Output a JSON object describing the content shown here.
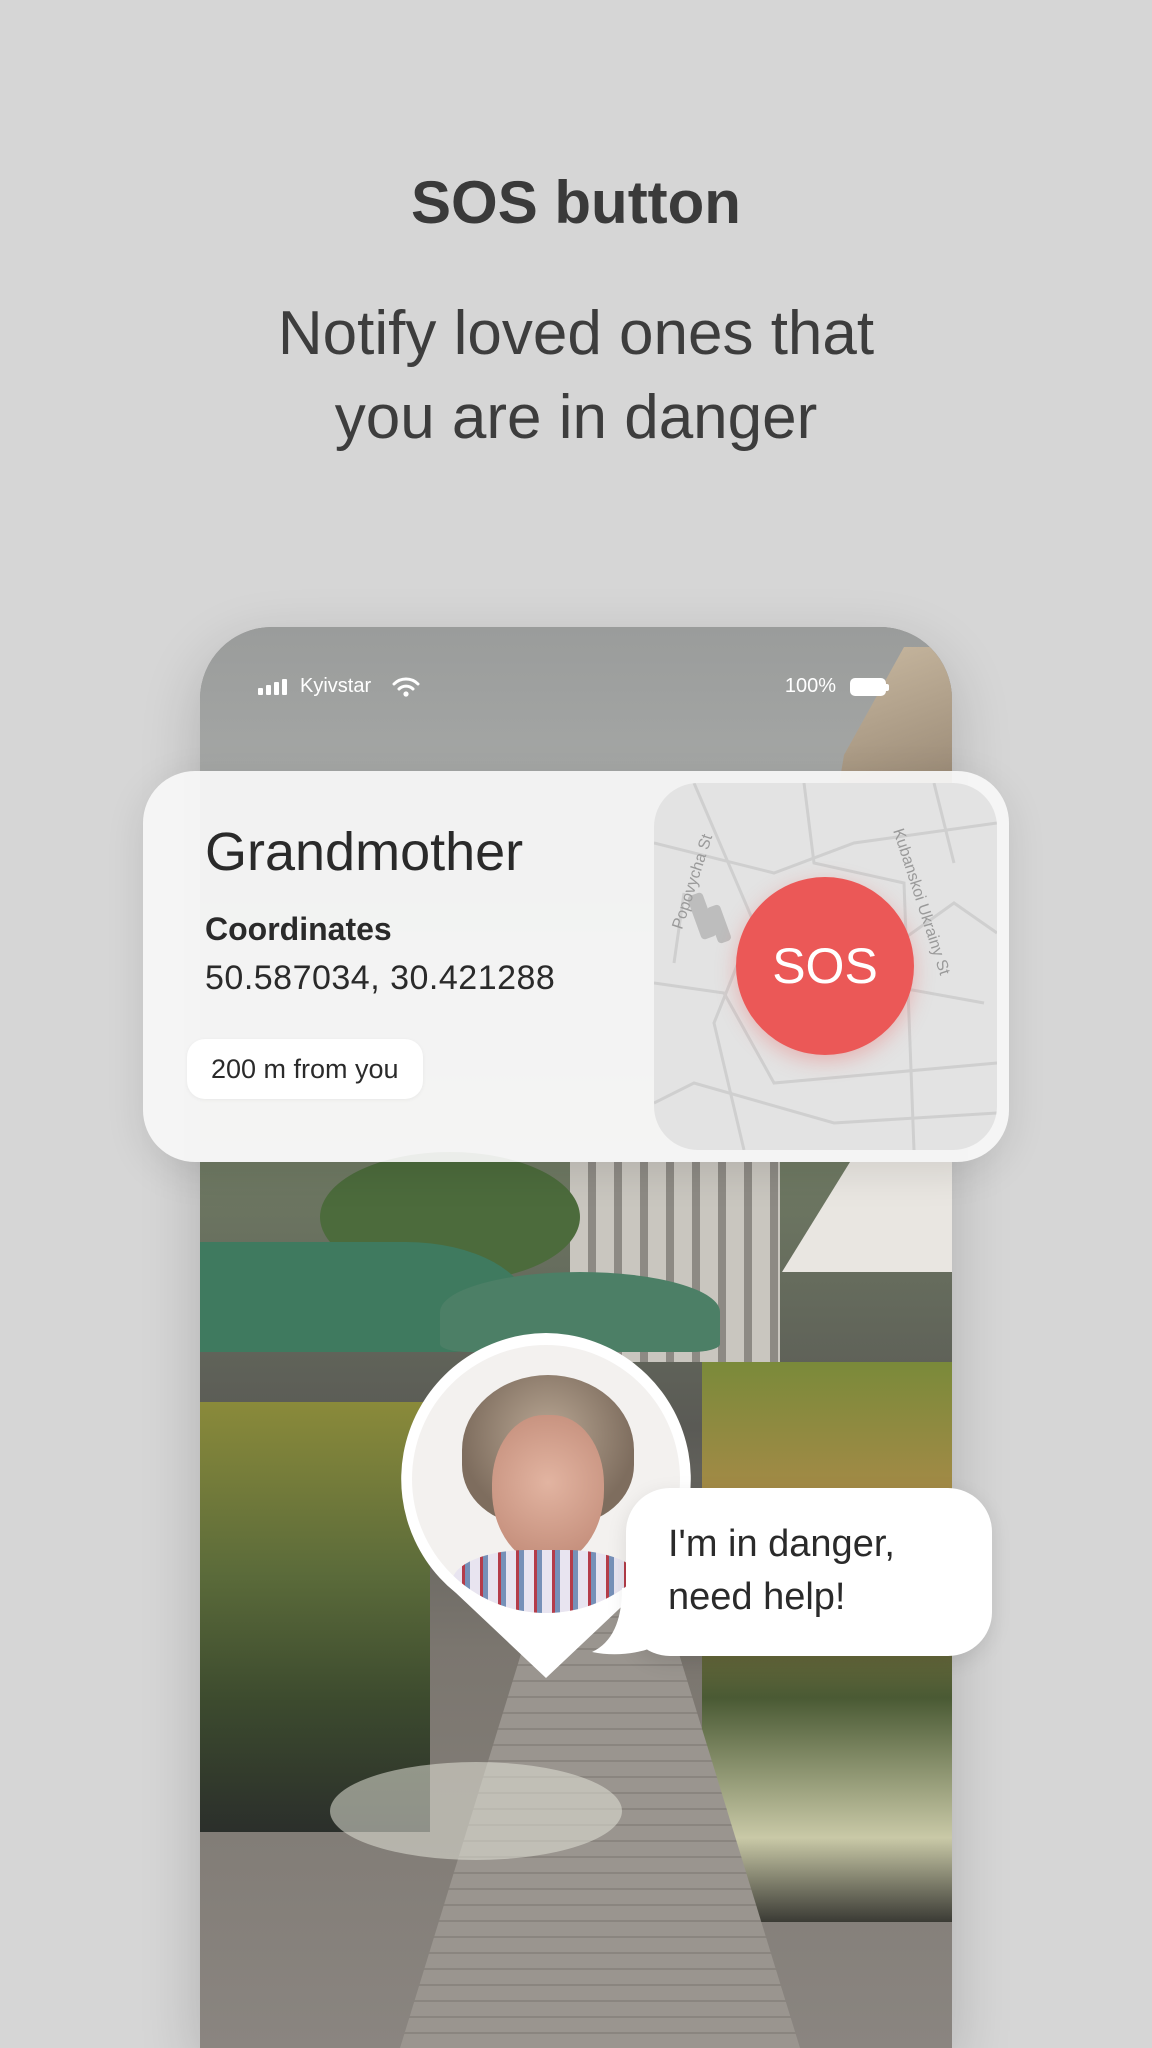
{
  "promo": {
    "title": "SOS button",
    "subtitle_line1": "Notify loved ones that",
    "subtitle_line2": "you are in danger"
  },
  "status_bar": {
    "carrier": "Kyivstar",
    "battery_percent": "100%",
    "icons": [
      "signal-bars-icon",
      "wifi-icon",
      "battery-icon"
    ]
  },
  "card": {
    "name": "Grandmother",
    "coordinates_label": "Coordinates",
    "coordinates_value": "50.587034, 30.421288",
    "distance": "200 m from you",
    "map": {
      "street_1": "Popovycha St",
      "street_2": "Kubanskoi Ukrainy St"
    },
    "sos_label": "SOS",
    "sos_color": "#eb5857"
  },
  "message": {
    "line1": "I'm in danger,",
    "line2": "need help!"
  }
}
